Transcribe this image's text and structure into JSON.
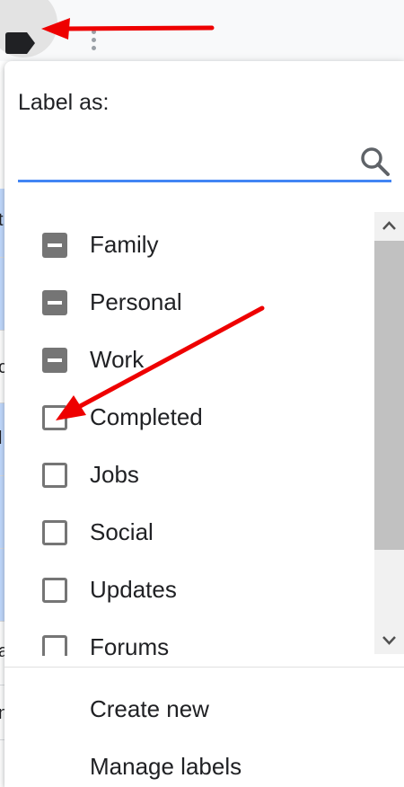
{
  "toolbar": {
    "label_button_icon": "label-icon",
    "more_button_icon": "more-vert-icon"
  },
  "panel": {
    "title": "Label as:",
    "search": {
      "value": "",
      "placeholder": "",
      "icon": "search-icon",
      "accent_color": "#4285f4"
    },
    "labels": [
      {
        "label": "Family",
        "state": "indeterminate"
      },
      {
        "label": "Personal",
        "state": "indeterminate"
      },
      {
        "label": "Work",
        "state": "indeterminate"
      },
      {
        "label": "Completed",
        "state": "unchecked"
      },
      {
        "label": "Jobs",
        "state": "unchecked"
      },
      {
        "label": "Social",
        "state": "unchecked"
      },
      {
        "label": "Updates",
        "state": "unchecked"
      },
      {
        "label": "Forums",
        "state": "unchecked"
      }
    ],
    "actions": {
      "create_new": "Create new",
      "manage_labels": "Manage labels"
    }
  },
  "background_list": {
    "peek_letters": [
      "t",
      "c",
      "l",
      "a",
      "n"
    ]
  },
  "annotation": {
    "arrow_color": "#ee0000"
  }
}
